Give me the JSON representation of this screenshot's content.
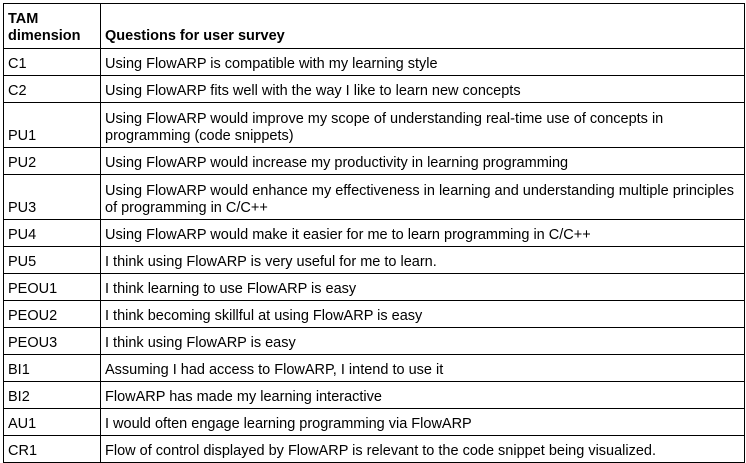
{
  "table": {
    "headers": {
      "dimension": "TAM dimension",
      "question": "Questions for user survey"
    },
    "rows": [
      {
        "dim": "C1",
        "question": "Using FlowARP is compatible with my learning style"
      },
      {
        "dim": "C2",
        "question": "Using FlowARP fits well with the way I like to learn new concepts"
      },
      {
        "dim": "PU1",
        "question": "Using FlowARP would improve my scope of understanding real-time use of concepts in programming (code snippets)"
      },
      {
        "dim": "PU2",
        "question": "Using FlowARP would increase my productivity in learning programming"
      },
      {
        "dim": "PU3",
        "question": "Using FlowARP would enhance my effectiveness in learning and understanding multiple principles of programming in C/C++"
      },
      {
        "dim": "PU4",
        "question": "Using FlowARP would make it easier for me to learn programming in C/C++"
      },
      {
        "dim": "PU5",
        "question": "I think using FlowARP is very useful for me to learn."
      },
      {
        "dim": "PEOU1",
        "question": "I think learning to use FlowARP is easy"
      },
      {
        "dim": "PEOU2",
        "question": "I think becoming skillful at using FlowARP is easy"
      },
      {
        "dim": "PEOU3",
        "question": "I think using FlowARP is easy"
      },
      {
        "dim": "BI1",
        "question": "Assuming I had access to FlowARP, I intend to use it"
      },
      {
        "dim": "BI2",
        "question": "FlowARP has made my learning interactive"
      },
      {
        "dim": "AU1",
        "question": "I would often engage learning programming via FlowARP"
      },
      {
        "dim": "CR1",
        "question": "Flow of control displayed by FlowARP is relevant to the code snippet being visualized."
      }
    ]
  }
}
